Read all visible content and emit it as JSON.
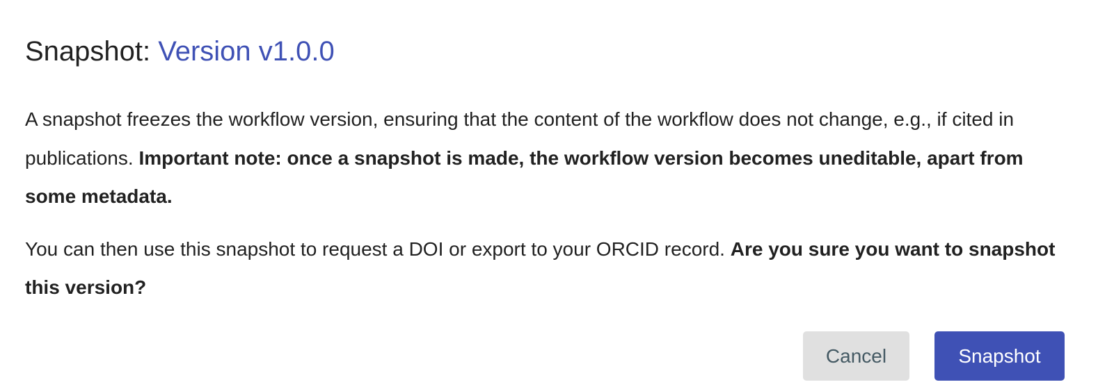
{
  "dialog": {
    "title_prefix": "Snapshot: ",
    "title_version": "Version v1.0.0",
    "paragraph1_text": "A snapshot freezes the workflow version, ensuring that the content of the workflow does not change, e.g., if cited in publications. ",
    "paragraph1_bold": "Important note: once a snapshot is made, the workflow version becomes uneditable, apart from some metadata.",
    "paragraph2_text": "You can then use this snapshot to request a DOI or export to your ORCID record. ",
    "paragraph2_bold": "Are you sure you want to snapshot this version?",
    "cancel_label": "Cancel",
    "snapshot_label": "Snapshot"
  },
  "colors": {
    "accent": "#3f51b5",
    "cancel_bg": "#e0e0e0",
    "cancel_text": "#455a64",
    "text": "#212121"
  }
}
